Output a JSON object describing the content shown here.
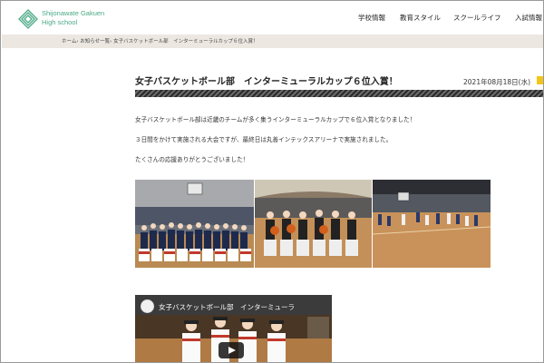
{
  "header": {
    "logo_line1": "Shijonawate Gakuen",
    "logo_line2": "High school",
    "nav": [
      "学校情報",
      "教育スタイル",
      "スクールライフ",
      "入試情報"
    ]
  },
  "breadcrumb": "ホーム› お知らせ一覧› 女子バスケットボール部　インターミューラルカップ６位入賞！",
  "article": {
    "title": "女子バスケットボール部　インターミューラルカップ６位入賞！",
    "date": "2021年08月18日(水)",
    "paragraphs": [
      "女子バスケットボール部は近畿のチームが多く集うインターミューラルカップで６位入賞となりました！",
      "３日間をかけて実施される大会ですが、最終日は丸善インテックスアリーナで実施されました。",
      "たくさんの応援ありがとうございました！"
    ]
  },
  "video": {
    "title": "女子バスケットボール部　インターミューラ"
  },
  "colors": {
    "brand_green": "#49a985",
    "breadcrumb_bg": "#ece7e1",
    "date_tag": "#f2c51a"
  },
  "icons": {
    "logo": "school-emblem-icon",
    "play": "play-icon"
  }
}
